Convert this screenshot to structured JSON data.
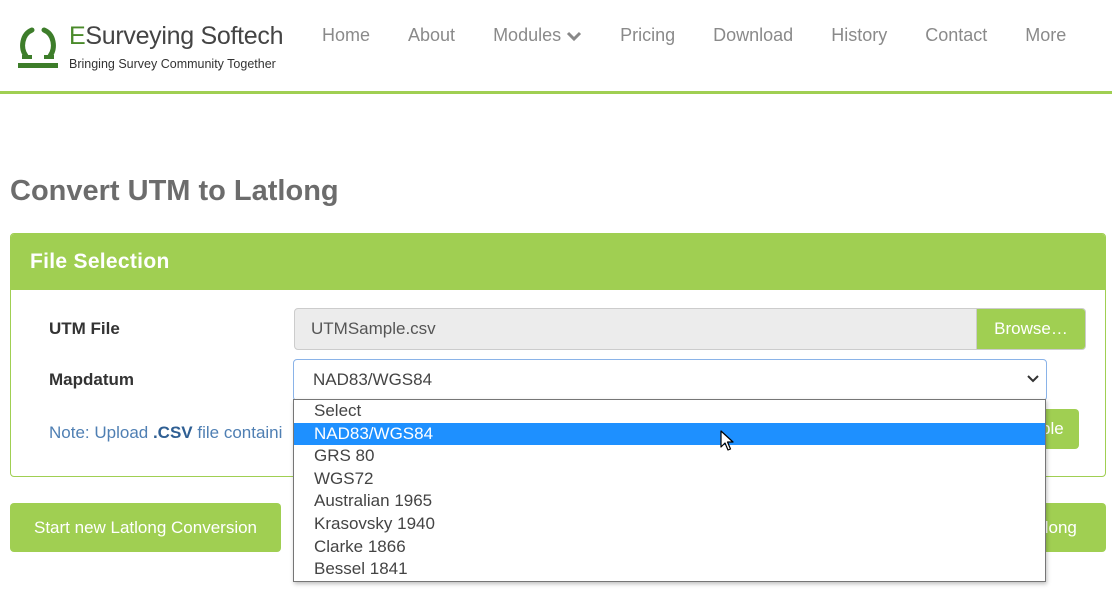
{
  "brand": {
    "name_prefix": "E",
    "name_rest": "Surveying Softech",
    "tagline": "Bringing Survey Community Together"
  },
  "nav": {
    "home": "Home",
    "about": "About",
    "modules": "Modules",
    "pricing": "Pricing",
    "download": "Download",
    "history": "History",
    "contact": "Contact",
    "more": "More"
  },
  "page_title": "Convert UTM to Latlong",
  "panel": {
    "heading": "File Selection",
    "utm_file_label": "UTM File",
    "utm_file_value": "UTMSample.csv",
    "browse_label": "Browse…",
    "mapdatum_label": "Mapdatum",
    "mapdatum_value": "NAD83/WGS84",
    "note_prefix": "Note: Upload ",
    "note_ext": ".CSV",
    "note_suffix": " file containi",
    "sample_button_fragment": "ple"
  },
  "dropdown": {
    "options": [
      "Select",
      "NAD83/WGS84",
      "GRS 80",
      "WGS72",
      "Australian 1965",
      "Krasovsky 1940",
      "Clarke 1866",
      "Bessel 1841"
    ],
    "highlighted": "NAD83/WGS84"
  },
  "buttons": {
    "start_new": "Start new Latlong Conversion",
    "convert_fragment": "tlong"
  },
  "colors": {
    "accent": "#a0cf52",
    "highlight": "#1e90ff",
    "note_text": "#4f7fb3"
  },
  "icons": [
    "logo-mark-icon",
    "chevron-down-icon",
    "select-chevron-icon",
    "mouse-cursor-icon"
  ]
}
